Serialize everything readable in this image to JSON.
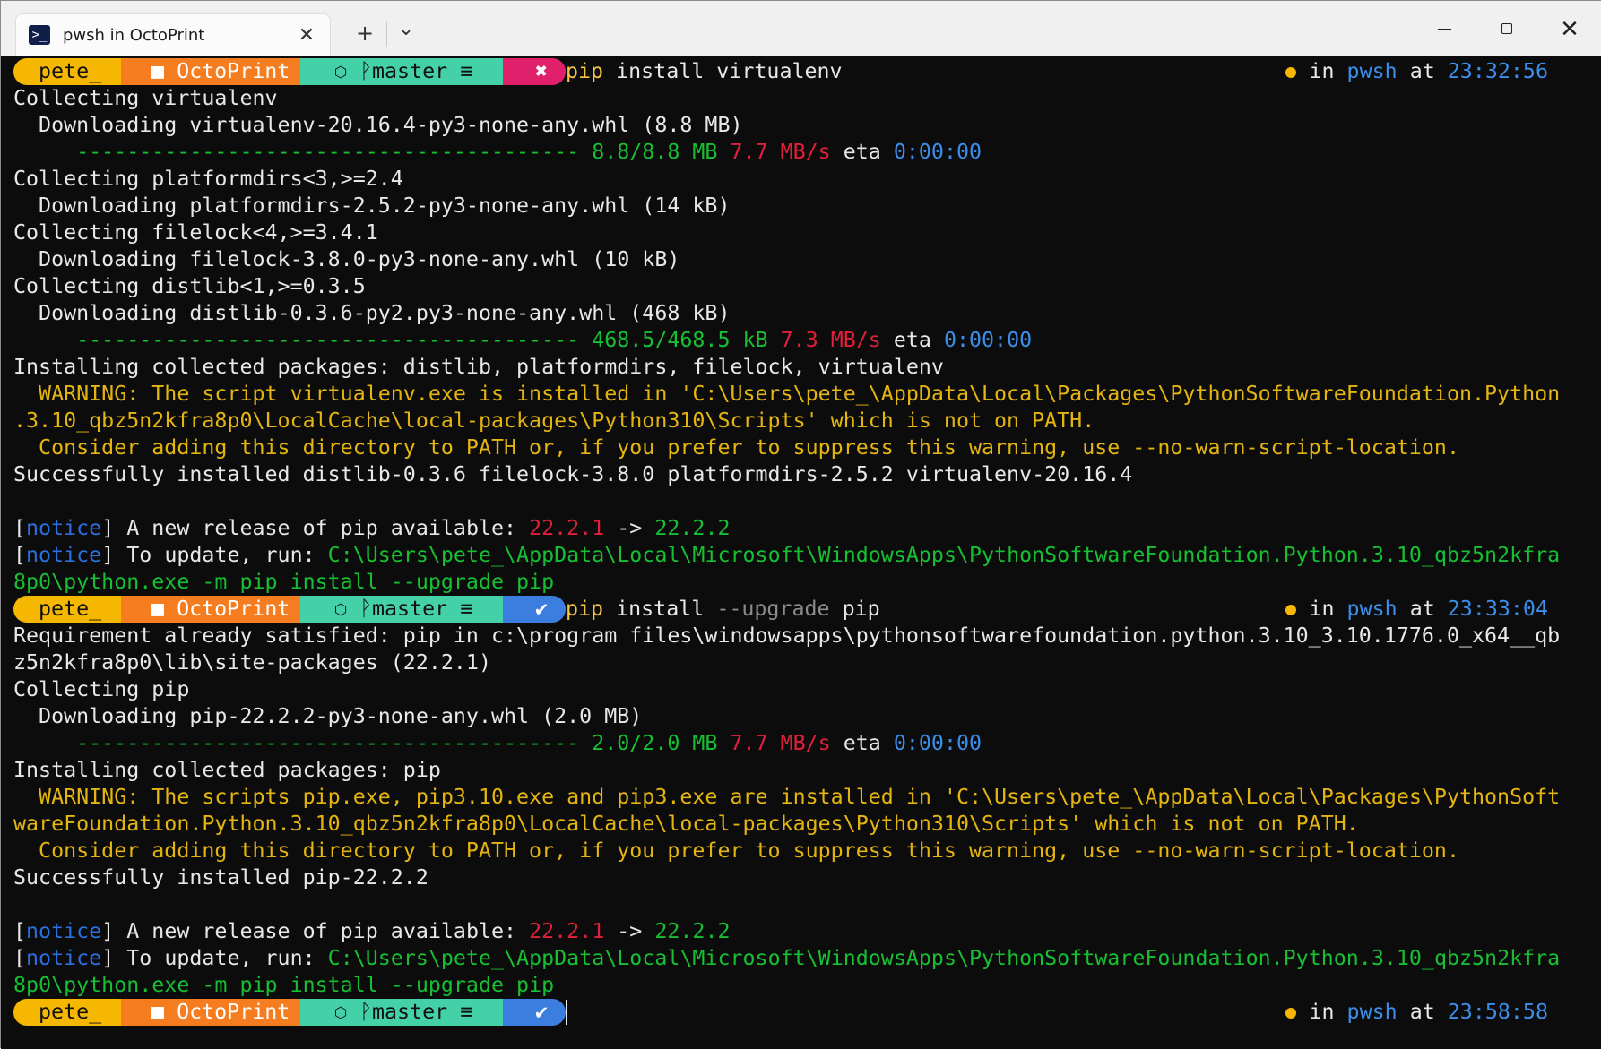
{
  "tab": {
    "title": "pwsh in OctoPrint",
    "icon": "powershell-icon"
  },
  "titlebar": {
    "new_tab": "+",
    "dropdown": "⌄",
    "close_tab": "✕",
    "minimize": "minimize-icon",
    "maximize": "maximize-icon",
    "close": "✕"
  },
  "prompt": {
    "user": "pete_",
    "folder_glyph": "■",
    "dir": "OctoPrint",
    "git_glyph": "⬡",
    "branch_glyph": "ᚹ",
    "branch": "master",
    "eq": "≡",
    "fail": "✖",
    "ok": "✔"
  },
  "colors": {
    "user": "#f5b700",
    "dir": "#f57c1f",
    "git": "#44d1a8",
    "fail": "#e0206a",
    "ok": "#3b7ee0"
  },
  "right_prompt": {
    "in": "in",
    "shell": "pwsh",
    "at": "at",
    "times": [
      "23:32:56",
      "23:33:04",
      "23:58:58"
    ]
  },
  "cmd1": {
    "a": "pip",
    "b": " install virtualenv"
  },
  "cmd2": {
    "a": "pip",
    "b": " install ",
    "c": "--upgrade",
    "d": " pip"
  },
  "lines": {
    "l1": "Collecting virtualenv",
    "l2": "  Downloading virtualenv-20.16.4-py3-none-any.whl (8.8 MB)",
    "bar": "     ----------------------------------------",
    "p1a": " 8.8/8.8 MB",
    "p1b": " 7.7 MB/s",
    "p1c": " eta ",
    "p1d": "0:00:00",
    "l4": "Collecting platformdirs<3,>=2.4",
    "l5": "  Downloading platformdirs-2.5.2-py3-none-any.whl (14 kB)",
    "l6": "Collecting filelock<4,>=3.4.1",
    "l7": "  Downloading filelock-3.8.0-py3-none-any.whl (10 kB)",
    "l8": "Collecting distlib<1,>=0.3.5",
    "l9": "  Downloading distlib-0.3.6-py2.py3-none-any.whl (468 kB)",
    "p2a": " 468.5/468.5 kB",
    "p2b": " 7.3 MB/s",
    "p2c": " eta ",
    "p2d": "0:00:00",
    "l11": "Installing collected packages: distlib, platformdirs, filelock, virtualenv",
    "w1a": "  WARNING: The script virtualenv.exe is installed in 'C:\\Users\\pete_\\AppData\\Local\\Packages\\PythonSoftwareFoundation.Python",
    "w1b": ".3.10_qbz5n2kfra8p0\\LocalCache\\local-packages\\Python310\\Scripts' which is not on PATH.",
    "w1c": "  Consider adding this directory to PATH or, if you prefer to suppress this warning, use --no-warn-script-location.",
    "s1": "Successfully installed distlib-0.3.6 filelock-3.8.0 platformdirs-2.5.2 virtualenv-20.16.4",
    "n_open": "[",
    "n_word": "notice",
    "n_close": "]",
    "n1": " A new release of pip available: ",
    "old": "22.2.1",
    "arrow": " -> ",
    "new": "22.2.2",
    "n2": " To update, run: ",
    "upd1": "C:\\Users\\pete_\\AppData\\Local\\Microsoft\\WindowsApps\\PythonSoftwareFoundation.Python.3.10_qbz5n2kfra",
    "upd2": "8p0\\python.exe -m pip install --upgrade pip",
    "r1": "Requirement already satisfied: pip in c:\\program files\\windowsapps\\pythonsoftwarefoundation.python.3.10_3.10.1776.0_x64__qb",
    "r2": "z5n2kfra8p0\\lib\\site-packages (22.2.1)",
    "c1": "Collecting pip",
    "c2": "  Downloading pip-22.2.2-py3-none-any.whl (2.0 MB)",
    "p3a": " 2.0/2.0 MB",
    "p3b": " 7.7 MB/s",
    "p3c": " eta ",
    "p3d": "0:00:00",
    "i2": "Installing collected packages: pip",
    "w2a": "  WARNING: The scripts pip.exe, pip3.10.exe and pip3.exe are installed in 'C:\\Users\\pete_\\AppData\\Local\\Packages\\PythonSoft",
    "w2b": "wareFoundation.Python.3.10_qbz5n2kfra8p0\\LocalCache\\local-packages\\Python310\\Scripts' which is not on PATH.",
    "w2c": "  Consider adding this directory to PATH or, if you prefer to suppress this warning, use --no-warn-script-location.",
    "s2": "Successfully installed pip-22.2.2"
  }
}
